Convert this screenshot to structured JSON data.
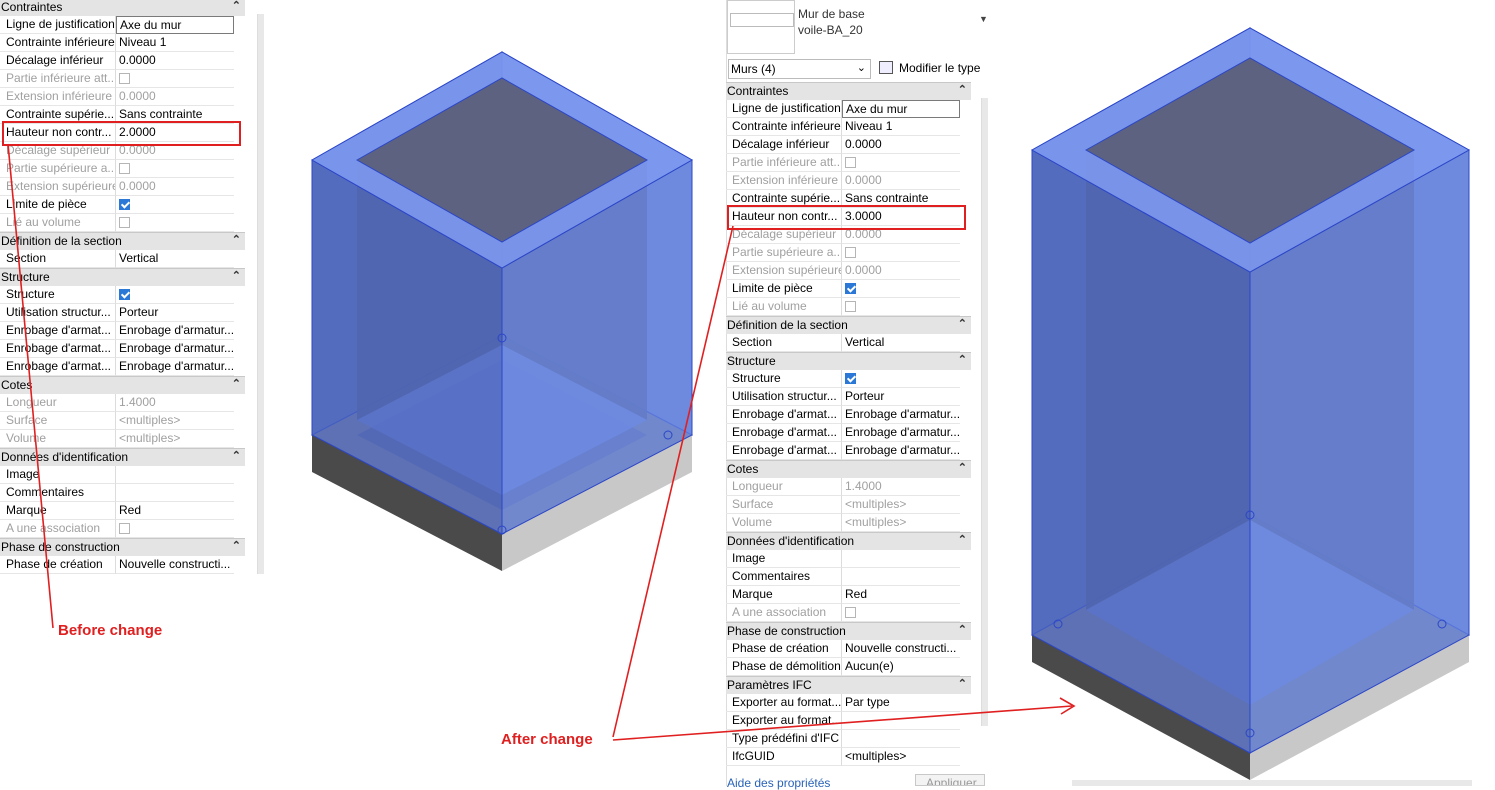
{
  "left_panel": {
    "categories": {
      "contraintes": "Contraintes",
      "section": "Définition de la section",
      "structure": "Structure",
      "cotes": "Cotes",
      "identification": "Données d'identification",
      "phase": "Phase de construction"
    },
    "rows": {
      "r1": {
        "name": "Ligne de justification",
        "value": "Axe du mur"
      },
      "r2": {
        "name": "Contrainte inférieure",
        "value": "Niveau 1"
      },
      "r3": {
        "name": "Décalage inférieur",
        "value": "0.0000"
      },
      "r4": {
        "name": "Partie inférieure att...",
        "value": ""
      },
      "r5": {
        "name": "Extension inférieure",
        "value": "0.0000"
      },
      "r6": {
        "name": "Contrainte supérie...",
        "value": "Sans contrainte"
      },
      "r7": {
        "name": "Hauteur non contr...",
        "value": "2.0000"
      },
      "r8": {
        "name": "Décalage supérieur",
        "value": "0.0000"
      },
      "r9": {
        "name": "Partie supérieure a...",
        "value": ""
      },
      "r10": {
        "name": "Extension supérieure",
        "value": "0.0000"
      },
      "r11": {
        "name": "Limite de pièce",
        "value": ""
      },
      "r12": {
        "name": "Lié au volume",
        "value": ""
      },
      "r13": {
        "name": "Section",
        "value": "Vertical"
      },
      "r14": {
        "name": "Structure",
        "value": ""
      },
      "r15": {
        "name": "Utilisation structur...",
        "value": "Porteur"
      },
      "r16": {
        "name": "Enrobage d'armat...",
        "value": "Enrobage d'armatur..."
      },
      "r17": {
        "name": "Enrobage d'armat...",
        "value": "Enrobage d'armatur..."
      },
      "r18": {
        "name": "Enrobage d'armat...",
        "value": "Enrobage d'armatur..."
      },
      "r19": {
        "name": "Longueur",
        "value": "1.4000"
      },
      "r20": {
        "name": "Surface",
        "value": "<multiples>"
      },
      "r21": {
        "name": "Volume",
        "value": "<multiples>"
      },
      "r22": {
        "name": "Image",
        "value": ""
      },
      "r23": {
        "name": "Commentaires",
        "value": ""
      },
      "r24": {
        "name": "Marque",
        "value": "Red"
      },
      "r25": {
        "name": "A une association",
        "value": ""
      },
      "r26": {
        "name": "Phase de création",
        "value": "Nouvelle constructi..."
      }
    }
  },
  "right_panel": {
    "type_name_line1": "Mur de base",
    "type_name_line2": "voile-BA_20",
    "selector": "Murs (4)",
    "edit_type": "Modifier le type",
    "categories": {
      "contraintes": "Contraintes",
      "section": "Définition de la section",
      "structure": "Structure",
      "cotes": "Cotes",
      "identification": "Données d'identification",
      "phase": "Phase de construction",
      "ifc": "Paramètres IFC"
    },
    "rows": {
      "r1": {
        "name": "Ligne de justification",
        "value": "Axe du mur"
      },
      "r2": {
        "name": "Contrainte inférieure",
        "value": "Niveau 1"
      },
      "r3": {
        "name": "Décalage inférieur",
        "value": "0.0000"
      },
      "r4": {
        "name": "Partie inférieure att...",
        "value": ""
      },
      "r5": {
        "name": "Extension inférieure",
        "value": "0.0000"
      },
      "r6": {
        "name": "Contrainte supérie...",
        "value": "Sans contrainte"
      },
      "r7": {
        "name": "Hauteur non contr...",
        "value": "3.0000"
      },
      "r8": {
        "name": "Décalage supérieur",
        "value": "0.0000"
      },
      "r9": {
        "name": "Partie supérieure a...",
        "value": ""
      },
      "r10": {
        "name": "Extension supérieure",
        "value": "0.0000"
      },
      "r11": {
        "name": "Limite de pièce",
        "value": ""
      },
      "r12": {
        "name": "Lié au volume",
        "value": ""
      },
      "r13": {
        "name": "Section",
        "value": "Vertical"
      },
      "r14": {
        "name": "Structure",
        "value": ""
      },
      "r15": {
        "name": "Utilisation structur...",
        "value": "Porteur"
      },
      "r16": {
        "name": "Enrobage d'armat...",
        "value": "Enrobage d'armatur..."
      },
      "r17": {
        "name": "Enrobage d'armat...",
        "value": "Enrobage d'armatur..."
      },
      "r18": {
        "name": "Enrobage d'armat...",
        "value": "Enrobage d'armatur..."
      },
      "r19": {
        "name": "Longueur",
        "value": "1.4000"
      },
      "r20": {
        "name": "Surface",
        "value": "<multiples>"
      },
      "r21": {
        "name": "Volume",
        "value": "<multiples>"
      },
      "r22": {
        "name": "Image",
        "value": ""
      },
      "r23": {
        "name": "Commentaires",
        "value": ""
      },
      "r24": {
        "name": "Marque",
        "value": "Red"
      },
      "r25": {
        "name": "A une association",
        "value": ""
      },
      "r26": {
        "name": "Phase de création",
        "value": "Nouvelle constructi..."
      },
      "r27": {
        "name": "Phase de démolition",
        "value": "Aucun(e)"
      },
      "r28": {
        "name": "Exporter au format...",
        "value": "Par type"
      },
      "r29": {
        "name": "Exporter au format...",
        "value": ""
      },
      "r30": {
        "name": "Type prédéfini d'IFC",
        "value": ""
      },
      "r31": {
        "name": "IfcGUID",
        "value": "<multiples>"
      }
    },
    "help_link": "Aide des propriétés",
    "apply_button": "Appliquer"
  },
  "annotations": {
    "before": "Before change",
    "after": "After change"
  },
  "colors": {
    "annotation_red": "#e02020",
    "wall_blue": "#5a7ee8",
    "wall_edge": "#2244cc",
    "slab_gray": "#9a9a9a"
  }
}
